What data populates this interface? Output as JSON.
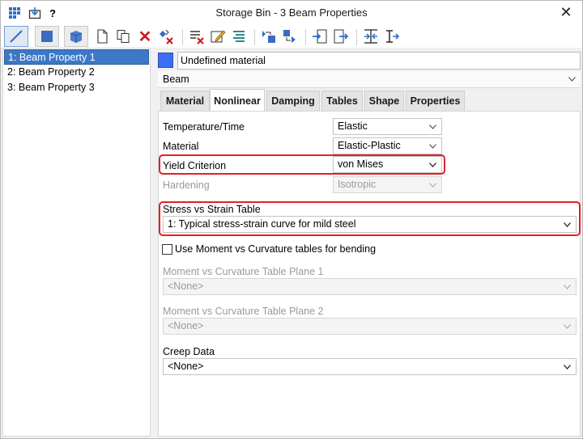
{
  "window": {
    "title": "Storage Bin - 3 Beam Properties"
  },
  "titlebar_icons": [
    "grid-icon",
    "download-icon"
  ],
  "titlebar_help": "?",
  "toolbar": {
    "buttons": [
      "beam-line-icon",
      "plate-square-icon",
      "brick-cube-icon",
      "new-document-icon",
      "copy-icon",
      "delete-icon",
      "delete-unused-icon",
      "remove-list-icon",
      "edit-icon",
      "list-icon",
      "assign-icon",
      "reassign-icon",
      "import-icon",
      "export-icon",
      "section-icon",
      "beam-section-icon"
    ]
  },
  "property_list": {
    "items": [
      "1: Beam Property 1",
      "2: Beam Property 2",
      "3: Beam Property 3"
    ],
    "selected_index": 0
  },
  "material": {
    "color": "#3a6ef5",
    "name": "Undefined material",
    "type": "Beam"
  },
  "tabs": [
    "Material",
    "Nonlinear",
    "Damping",
    "Tables",
    "Shape",
    "Properties"
  ],
  "active_tab": "Nonlinear",
  "nonlinear": {
    "temperature_time_label": "Temperature/Time",
    "temperature_time_value": "Elastic",
    "material_label": "Material",
    "material_value": "Elastic-Plastic",
    "yield_label": "Yield Criterion",
    "yield_value": "von Mises",
    "hardening_label": "Hardening",
    "hardening_value": "Isotropic",
    "stress_strain_label": "Stress vs Strain Table",
    "stress_strain_value": "1: Typical stress-strain curve for mild steel",
    "use_moment_label": "Use Moment vs Curvature tables for bending",
    "use_moment_checked": false,
    "plane1_label": "Moment vs Curvature Table Plane 1",
    "plane1_value": "<None>",
    "plane2_label": "Moment vs Curvature Table Plane 2",
    "plane2_value": "<None>",
    "creep_label": "Creep Data",
    "creep_value": "<None>"
  },
  "highlight_color": "#e0202a"
}
